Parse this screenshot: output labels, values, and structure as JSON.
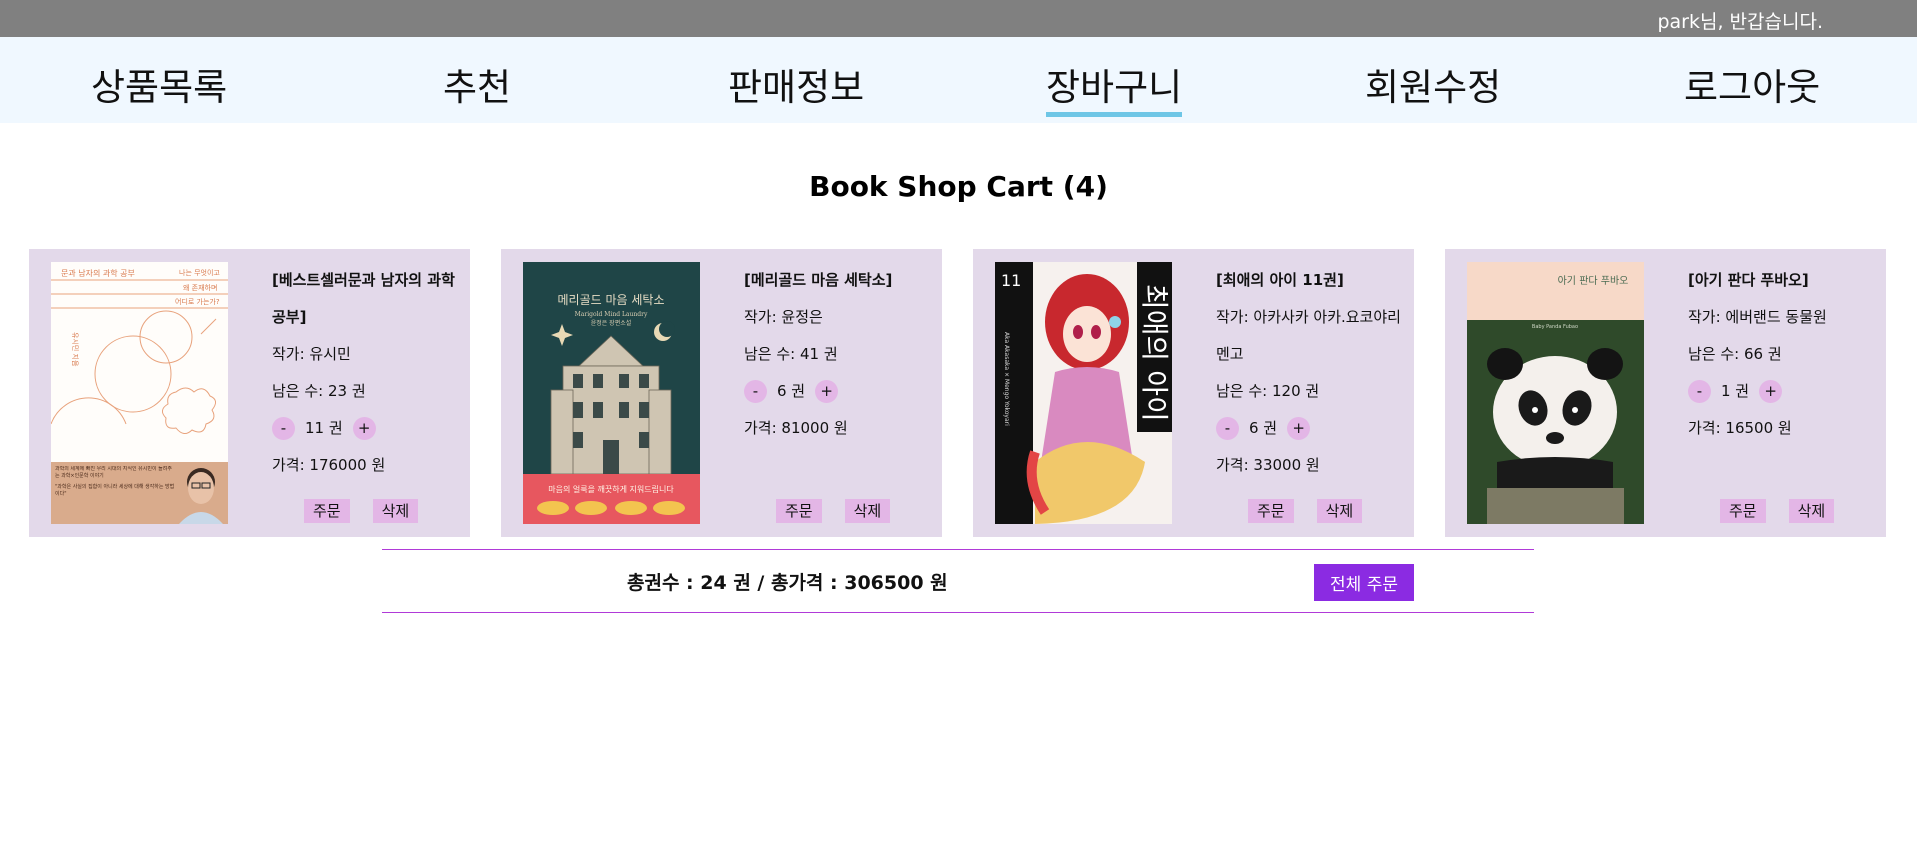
{
  "header": {
    "greeting": "park님, 반갑습니다."
  },
  "nav": {
    "items": [
      {
        "label": "상품목록"
      },
      {
        "label": "추천"
      },
      {
        "label": "판매정보"
      },
      {
        "label": "장바구니",
        "active": true
      },
      {
        "label": "회원수정"
      },
      {
        "label": "로그아웃"
      }
    ]
  },
  "page": {
    "title": "Book Shop Cart (4)"
  },
  "cart": {
    "items": [
      {
        "name": "[베스트셀러문과 남자의 과학 공부]",
        "author": "작가: 유시민",
        "stock": "남은 수: 23 권",
        "qty_minus": "-",
        "qty": "11 권",
        "qty_plus": "+",
        "price": "가격: 176000 원",
        "order": "주문",
        "delete": "삭제"
      },
      {
        "name": "[메리골드 마음 세탁소]",
        "author": "작가: 윤정은",
        "stock": "남은 수: 41 권",
        "qty_minus": "-",
        "qty": "6 권",
        "qty_plus": "+",
        "price": "가격: 81000 원",
        "order": "주문",
        "delete": "삭제"
      },
      {
        "name": "[최애의 아이 11권]",
        "author": "작가: 아카사카 아카.요코야리 멘고",
        "stock": "남은 수: 120 권",
        "qty_minus": "-",
        "qty": "6 권",
        "qty_plus": "+",
        "price": "가격: 33000 원",
        "order": "주문",
        "delete": "삭제"
      },
      {
        "name": "[아기 판다 푸바오]",
        "author": "작가: 에버랜드 동물원",
        "stock": "남은 수: 66 권",
        "qty_minus": "-",
        "qty": "1 권",
        "qty_plus": "+",
        "price": "가격: 16500 원",
        "order": "주문",
        "delete": "삭제"
      }
    ],
    "covers": [
      {
        "title": "문과 남자의 과학 공부",
        "taglines": [
          "나는 무엇이고",
          "왜 존재하며",
          "어디로 가는가?"
        ],
        "side_text": "유시민 지음",
        "blurb": "과학의 세계에 빠진 우리 시대의 지식인 유시민이 들려주는 과학×인문학 이야기",
        "quote": "\"과학은 사실의 집합이 아니라 세상에 대해 생각하는 방법이다\""
      },
      {
        "title": "메리골드 마음 세탁소",
        "english": "Marigold Mind Laundry",
        "author_line": "윤정은 장편소설",
        "banner": "마음의 얼룩을 깨끗하게 지워드립니다"
      },
      {
        "number": "11",
        "title": "최애의 아이",
        "credits": "Aka Akasaka × Mengo Yokoyari"
      },
      {
        "title": "아기 판다 푸바오",
        "subtitle": "Baby Panda Fubao"
      }
    ]
  },
  "summary": {
    "text": "총권수 : 24 권 / 총가격 : 306500 원",
    "order_all": "전체 주문"
  },
  "colors": {
    "topbar": "#808080",
    "nav_bg": "#f0f8ff",
    "card_bg": "#e3d9ea",
    "button_bg": "#e3b6e6",
    "accent": "#8b2be2",
    "active_underline": "#6ec6e6"
  }
}
